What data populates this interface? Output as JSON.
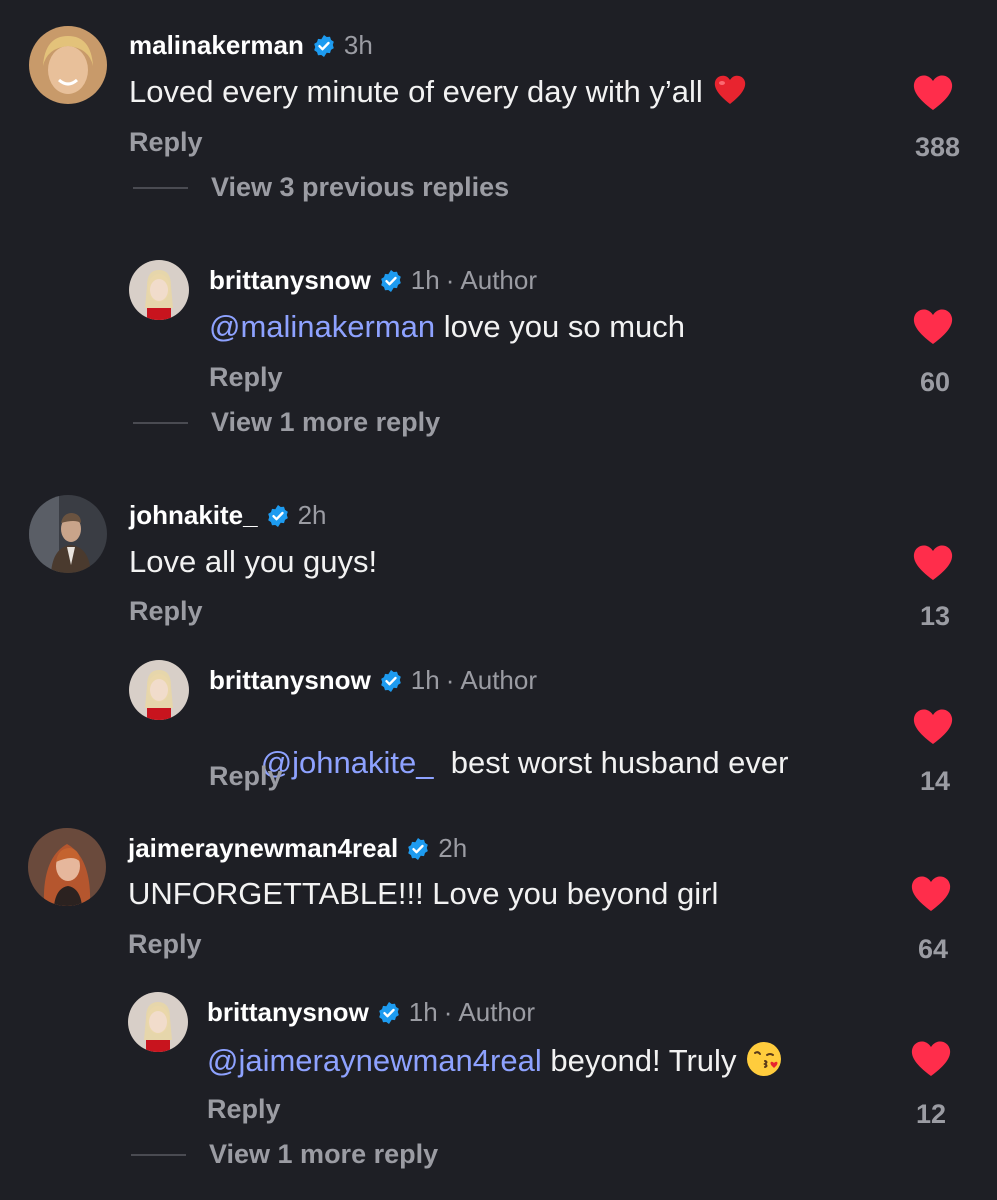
{
  "colors": {
    "background": "#1e1f25",
    "verified": "#1d9bf0",
    "like": "#ff2d4b",
    "mention": "#8ea2ff",
    "muted": "#9b9ca3"
  },
  "comments": [
    {
      "username": "malinakerman",
      "verified": true,
      "time": "3h",
      "text": "Loved every minute of every day with y’all",
      "emoji": "red-heart-emoji",
      "reply_label": "Reply",
      "likes": "388",
      "liked": true,
      "view_replies": "View 3 previous replies"
    },
    {
      "username": "brittanysnow",
      "verified": true,
      "time": "1h",
      "author_sep": "·",
      "author_label": "Author",
      "mention": "@malinakerman",
      "text": " love you so much",
      "reply_label": "Reply",
      "likes": "60",
      "liked": true,
      "view_replies": "View 1 more reply"
    },
    {
      "username": "johnakite_",
      "verified": true,
      "time": "2h",
      "text": "Love all you guys!",
      "reply_label": "Reply",
      "likes": "13",
      "liked": true
    },
    {
      "username": "brittanysnow",
      "verified": true,
      "time": "1h",
      "author_sep": "·",
      "author_label": "Author",
      "mention": "@johnakite_",
      "text": "  best worst husband ever",
      "reply_label": "Reply",
      "likes": "14",
      "liked": true
    },
    {
      "username": "jaimeraynewman4real",
      "verified": true,
      "time": "2h",
      "text": "UNFORGETTABLE!!! Love you beyond girl",
      "reply_label": "Reply",
      "likes": "64",
      "liked": true
    },
    {
      "username": "brittanysnow",
      "verified": true,
      "time": "1h",
      "author_sep": "·",
      "author_label": "Author",
      "mention": "@jaimeraynewman4real",
      "text": " beyond! Truly",
      "emoji": "kissing-face-emoji",
      "reply_label": "Reply",
      "likes": "12",
      "liked": true,
      "view_replies": "View 1 more reply"
    }
  ]
}
